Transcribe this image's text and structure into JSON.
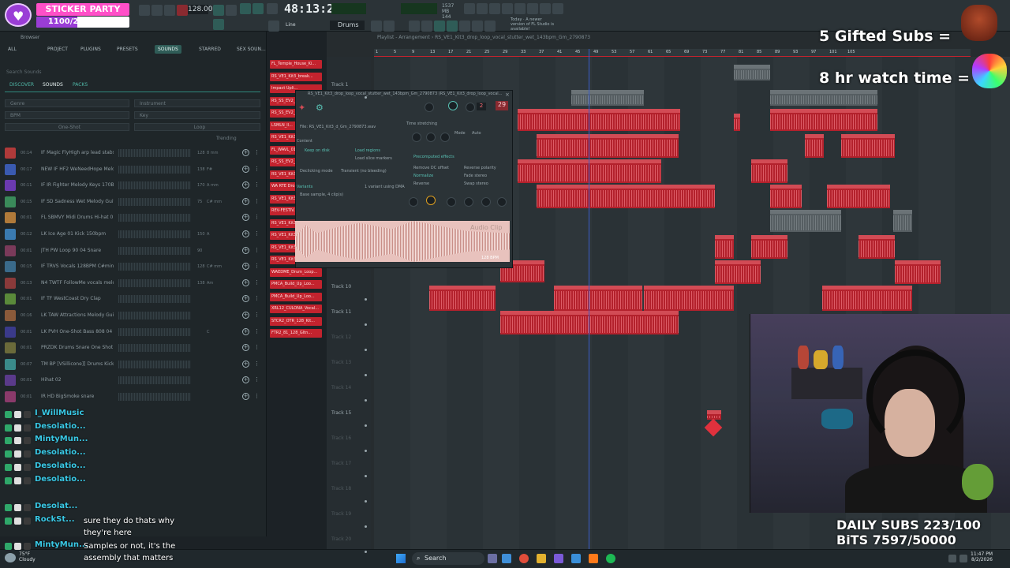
{
  "colors": {
    "accent": "#c3232e",
    "teal": "#2f5c57",
    "chat_name": "#39c9e6",
    "sticker": "#ff4fc8"
  },
  "sticker_party": {
    "title": "STICKER PARTY",
    "bits": "1100/2500 BITS",
    "progress": 0.44
  },
  "toolbar": {
    "tempo": "128.000",
    "timecode": "48:13:21",
    "cpu_text": "1537 MB\n144",
    "news_text": "Today · A newer version of FL Studio is available!",
    "pattern": "Drums",
    "line_label": "Line"
  },
  "browser": {
    "title": "Browser",
    "tabs": [
      "ALL",
      "PROJECT",
      "PLUGINS",
      "PRESETS",
      "SOUNDS",
      "STARRED",
      "SEX SOUN..."
    ],
    "active_tab": "SOUNDS",
    "search_placeholder": "Search Sounds",
    "sub_tabs": [
      "DISCOVER",
      "SOUNDS",
      "PACKS"
    ],
    "filters": [
      "Genre",
      "Instrument",
      "BPM",
      "Key",
      "One-Shot",
      "Loop"
    ],
    "sort": "Trending",
    "rows": [
      {
        "time": "00:14",
        "name": "IF Magic FlyHigh arp lead stabs m...",
        "bpm": "128",
        "meta": "8 mm"
      },
      {
        "time": "00:17",
        "name": "NEW IF HF2 WeNeedHope Melo...",
        "bpm": "138",
        "meta": "F#"
      },
      {
        "time": "00:11",
        "name": "IF IR Fighter Melody Keys 170BPM...",
        "bpm": "170",
        "meta": "A mm"
      },
      {
        "time": "00:15",
        "name": "IF SD Sadness Wet Melody Guitar...",
        "bpm": "75",
        "meta": "C# mm"
      },
      {
        "time": "00:01",
        "name": "FL SBMVY Midi Drums Hi-hat 01",
        "bpm": "",
        "meta": ""
      },
      {
        "time": "00:12",
        "name": "LK Ice Age 01 Kick 150bpm",
        "bpm": "150",
        "meta": "A"
      },
      {
        "time": "00:01",
        "name": "JTH PW Loop 90 04 Snare",
        "bpm": "90",
        "meta": ""
      },
      {
        "time": "00:15",
        "name": "IF TRVS Vocals 128BPM C#min",
        "bpm": "128",
        "meta": "C# mm"
      },
      {
        "time": "00:13",
        "name": "N4 TWTF FollowMe vocals melody...",
        "bpm": "138",
        "meta": "Am"
      },
      {
        "time": "00:01",
        "name": "IF TF WestCoast Dry Clap",
        "bpm": "",
        "meta": ""
      },
      {
        "time": "00:16",
        "name": "LK TAW Attractions Melody Guitar...",
        "bpm": "",
        "meta": ""
      },
      {
        "time": "00:01",
        "name": "LK PVH One-Shot Bass 808 04",
        "bpm": "",
        "meta": "C"
      },
      {
        "time": "00:01",
        "name": "PRZDK Drums Snare One Shot Cla...",
        "bpm": "",
        "meta": ""
      },
      {
        "time": "00:07",
        "name": "TM BP [VSillicone]] Drums Kick 13...",
        "bpm": "",
        "meta": ""
      },
      {
        "time": "00:01",
        "name": "Hihat 02",
        "bpm": "",
        "meta": ""
      },
      {
        "time": "00:01",
        "name": "IR HD BigSmoke snare",
        "bpm": "",
        "meta": ""
      }
    ]
  },
  "chat": [
    {
      "name": "I_WillMusic",
      "msg": ""
    },
    {
      "name": "Desolatio...",
      "msg": ""
    },
    {
      "name": "MintyMun...",
      "msg": ""
    },
    {
      "name": "Desolatio...",
      "msg": ""
    },
    {
      "name": "Desolatio...",
      "msg": ""
    },
    {
      "name": "Desolatio...",
      "msg": ""
    },
    {
      "name": "Desolat...",
      "msg": ""
    },
    {
      "name": "RockSt...",
      "msg": "sure they do thats why they're here"
    },
    {
      "name": "MintyMun...",
      "msg": "Samples or not, it's the assembly that matters"
    }
  ],
  "rack": [
    "FL_Temple_House_Ki...",
    "RS_VE1_Kit3_break...",
    "Impact Upli...",
    "RS_SS_EV2_Fx...",
    "RS_SS_EV2_Fx...",
    "LSMLN_ll...",
    "RS_VE1_Kit3...",
    "FL_WAVL_01...",
    "RS_SS_EV2_Fx...",
    "RS_VE1_Kit3...",
    "WA RTE Dro...",
    "RS_VE1_Kit3...",
    "REV-FESTIV...",
    "RS_VE1_Kit3...",
    "RS_VE1_Kit3...",
    "RS_VE1_Kit3...",
    "RS_VE1_Kit3...",
    "WAEDME_Drum_Loop...",
    "PMCA_Build_Up_Loo...",
    "PMCA_Build_Up_Loo...",
    "XRL12_CULONA_Vocal...",
    "STCR2_OTR_128_Kit...",
    "FTR2_81_128_Gltn..."
  ],
  "playlist": {
    "title": "Playlist - Arrangement › RS_VE1_Kit3_drop_loop_vocal_stutter_wet_143bpm_Gm_2790873",
    "ruler": [
      "1",
      "5",
      "9",
      "13",
      "17",
      "21",
      "25",
      "29",
      "33",
      "37",
      "41",
      "45",
      "49",
      "53",
      "57",
      "61",
      "65",
      "69",
      "73",
      "77",
      "81",
      "85",
      "89",
      "93",
      "97",
      "101",
      "105"
    ],
    "tracks": [
      "Track 1",
      "Track 10",
      "Track 11",
      "Track 12",
      "Track 13",
      "Track 14",
      "Track 15",
      "Track 16",
      "Track 17",
      "Track 18",
      "Track 19",
      "Track 20"
    ]
  },
  "popup": {
    "title": "RS_VE1_Kit3_drop_loop_vocal_stutter_wet_143bpm_Gm_2790873 (RS_VE1_Kit3_drop_loop_vocal...",
    "file": "File: RS_VE1_Kit3_d_Gm_2790873.wav",
    "time_stretching": "Time stretching",
    "mode_label": "Mode",
    "mode_value": "Auto",
    "content": "Content",
    "keep_on_disk": "Keep on disk",
    "load_regions": "Load regions",
    "load_slice": "Load slice markers",
    "declicking": "Declicking mode",
    "declicking_value": "Transient (no bleeding)",
    "variants": "Variants",
    "variants_value": "1 variant using DMA",
    "base_sample": "Base sample, 4 clip(s)",
    "precomputed": "Precomputed effects",
    "effects": [
      "Remove DC offset",
      "Reverse polarity",
      "Normalize",
      "Fade stereo",
      "Reverse",
      "Swap stereo"
    ],
    "number": "29",
    "channel": "2",
    "wave_label": "Audio Clip",
    "bpm": "128 BPM"
  },
  "stream": {
    "gifted": "5 Gifted Subs =",
    "watch": "8 hr watch time =",
    "daily": "DAILY SUBS 223/100",
    "bits": "BiTS 7597/50000"
  },
  "taskbar": {
    "weather_temp": "75°F",
    "weather_desc": "Cloudy",
    "search": "Search",
    "time": "11:47 PM",
    "date": "8/2/2026"
  }
}
